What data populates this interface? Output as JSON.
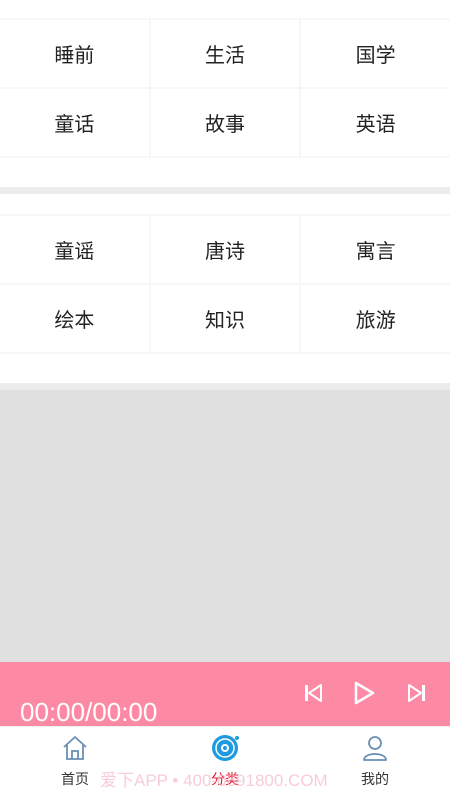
{
  "categories_group1": [
    {
      "label": "睡前"
    },
    {
      "label": "生活"
    },
    {
      "label": "国学"
    },
    {
      "label": "童话"
    },
    {
      "label": "故事"
    },
    {
      "label": "英语"
    }
  ],
  "categories_group2": [
    {
      "label": "童谣"
    },
    {
      "label": "唐诗"
    },
    {
      "label": "寓言"
    },
    {
      "label": "绘本"
    },
    {
      "label": "知识"
    },
    {
      "label": "旅游"
    }
  ],
  "player": {
    "time": "00:00/00:00",
    "prev_icon": "skip-previous-icon",
    "play_icon": "play-icon",
    "next_icon": "skip-next-icon",
    "bg_color": "#fd8aa5"
  },
  "tabbar": {
    "tabs": [
      {
        "label": "首页",
        "icon": "home-icon"
      },
      {
        "label": "分类",
        "icon": "category-disc-icon",
        "active": true
      },
      {
        "label": "我的",
        "icon": "user-icon"
      }
    ],
    "active_color": "#e0203a"
  },
  "watermark": "爱下APP • 400-0891800.COM"
}
